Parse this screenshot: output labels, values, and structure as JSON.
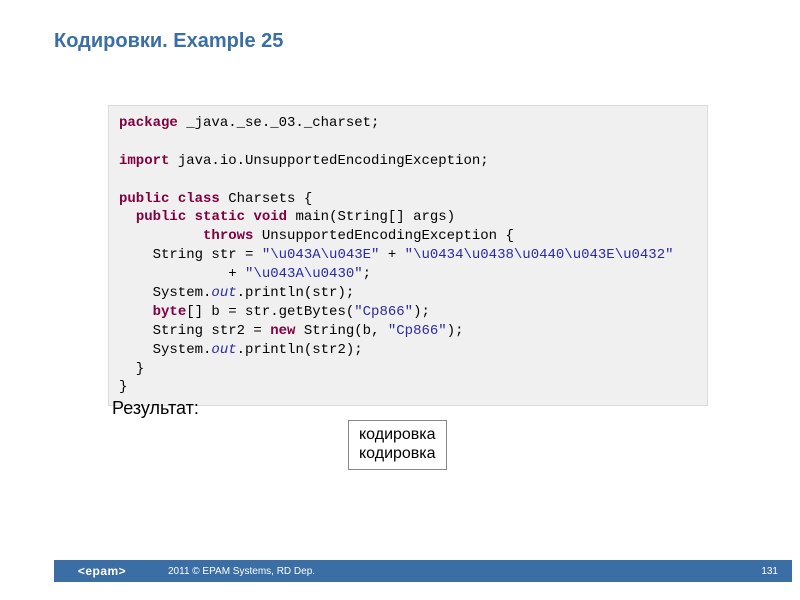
{
  "title": "Кодировки. Example 25",
  "code": {
    "kw_package": "package",
    "package_path": " _java._se._03._charset;",
    "kw_import": "import",
    "import_path": " java.io.UnsupportedEncodingException;",
    "kw_public": "public",
    "kw_class": "class",
    "class_name": " Charsets {",
    "kw_static": "static",
    "kw_void": "void",
    "main_sig": " main(String[] args)",
    "kw_throws": "throws",
    "throws_clause": " UnsupportedEncodingException {",
    "line_str_pre": "    String str = ",
    "str_lit1": "\"\\u043A\\u043E\"",
    "plus1": " + ",
    "str_lit2": "\"\\u0434\\u0438\\u0440\\u043E\\u0432\"",
    "line_str2_pre": "             + ",
    "str_lit3": "\"\\u043A\\u0430\"",
    "semicolon": ";",
    "sysout_pre": "    System.",
    "out_field": "out",
    "println_str": ".println(str);",
    "kw_byte": "byte",
    "byte_line": "[] b = str.getBytes(",
    "cp866_1": "\"Cp866\"",
    "byte_line_end": ");",
    "str2_pre": "    String str2 = ",
    "kw_new": "new",
    "str2_mid": " String(b, ",
    "cp866_2": "\"Cp866\"",
    "str2_end": ");",
    "println_str2": ".println(str2);",
    "close_inner": "  }",
    "close_outer": "}"
  },
  "result_label": "Результат:",
  "result_line1": "кодировка",
  "result_line2": "кодировка",
  "footer": {
    "logo": "<epam>",
    "text": "2011 © EPAM Systems, RD Dep.",
    "page": "131"
  }
}
